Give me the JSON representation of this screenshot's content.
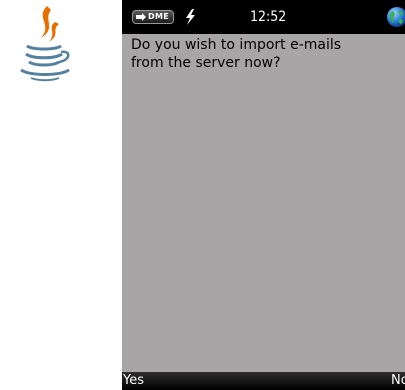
{
  "app": {
    "logo_icon": "java-coffee-cup-icon"
  },
  "status_bar": {
    "carrier": "DME",
    "signal_icon": "signal-icon",
    "charging_icon": "lightning-bolt-icon",
    "time": "12:52",
    "network_icon": "globe-icon"
  },
  "dialog": {
    "message_line1": "Do you wish to import e-mails",
    "message_line2": "from the server now?"
  },
  "softkeys": {
    "left_label": "Yes",
    "right_label": "No"
  },
  "colors": {
    "screen_background": "#a7a5a6",
    "status_bar": "#000000",
    "softkey_bar": "#000000",
    "text": "#000000",
    "logo_flame": "#e76f00",
    "logo_cup": "#5382a1"
  }
}
